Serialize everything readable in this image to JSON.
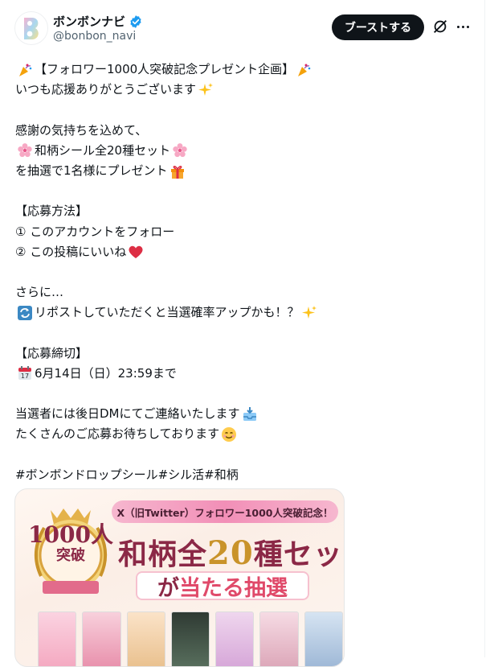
{
  "header": {
    "name": "ボンボンナビ",
    "handle": "@bonbon_navi",
    "boost_label": "ブーストする",
    "verified_icon": "verified-badge-icon",
    "grok_icon": "grok-icon",
    "more_icon": "more-options-icon"
  },
  "post": {
    "line1": "【フォロワー1000人突破記念プレゼント企画】",
    "line2": "いつも応援ありがとうございます",
    "line3": "感謝の気持ちを込めて、",
    "line4": "和柄シール全20種セット",
    "line5": "を抽選で1名様にプレゼント",
    "line6": "【応募方法】",
    "line7": "① このアカウントをフォロー",
    "line8": "② この投稿にいいね",
    "line9": "さらに…",
    "line10": "リポストしていただくと当選確率アップかも！？",
    "line11": "【応募締切】",
    "line12": "6月14日（日）23:59まで",
    "line13": "当選者には後日DMにてご連絡いたします",
    "line14": "たくさんのご応募お待ちしております",
    "line15": "#ボンボンドロップシール#シル活#和柄"
  },
  "media": {
    "banner": "X（旧Twitter）フォロワー1000人突破記念！",
    "title_pre": "和柄全",
    "title_num": "20",
    "title_post": "種セット",
    "sub_pre": "が",
    "sub_emph": "当たる抽選",
    "medal_num": "1000人",
    "medal_sub": "突破"
  },
  "colors": {
    "text": "#0f1419",
    "handle": "#536471",
    "boost_bg": "#0f1419",
    "accent_pink": "#f28fb7",
    "title_red": "#8b2846",
    "gold": "#c9932a"
  }
}
